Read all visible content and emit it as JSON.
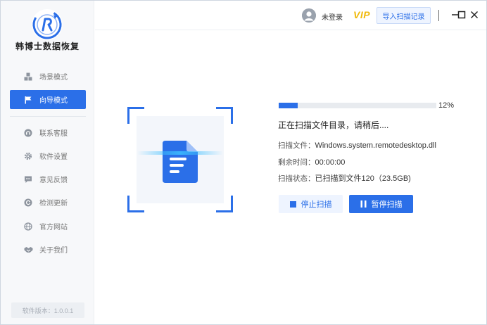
{
  "app": {
    "brand_name": "韩博士数据恢复",
    "version_label": "软件版本：1.0.0.1",
    "accent_color": "#2b6fe8"
  },
  "sidebar": {
    "items": [
      {
        "label": "场景模式",
        "icon": "cubes-icon",
        "active": false
      },
      {
        "label": "向导模式",
        "icon": "flag-icon",
        "active": true
      },
      {
        "label": "联系客服",
        "icon": "headset-icon",
        "active": false
      },
      {
        "label": "软件设置",
        "icon": "gear-icon",
        "active": false
      },
      {
        "label": "意见反馈",
        "icon": "chat-bubble-icon",
        "active": false
      },
      {
        "label": "检测更新",
        "icon": "refresh-icon",
        "active": false
      },
      {
        "label": "官方网站",
        "icon": "globe-icon",
        "active": false
      },
      {
        "label": "关于我们",
        "icon": "handshake-icon",
        "active": false
      }
    ]
  },
  "header": {
    "login_status": "未登录",
    "vip_label": "VIP",
    "import_button": "导入扫描记录",
    "window_controls": [
      "minimize-icon",
      "maximize-icon",
      "close-icon"
    ]
  },
  "scan": {
    "progress_percent": 12,
    "progress_label": "12%",
    "status_text": "正在扫描文件目录，请稍后....",
    "file_label": "扫描文件：",
    "file_value": "Windows.system.remotedesktop.dll",
    "time_label": "剩余时间：",
    "time_value": "00:00:00",
    "state_label": "扫描状态：",
    "state_value": "已扫描到文件120（23.5GB)",
    "stop_button": "停止扫描",
    "pause_button": "暂停扫描"
  }
}
